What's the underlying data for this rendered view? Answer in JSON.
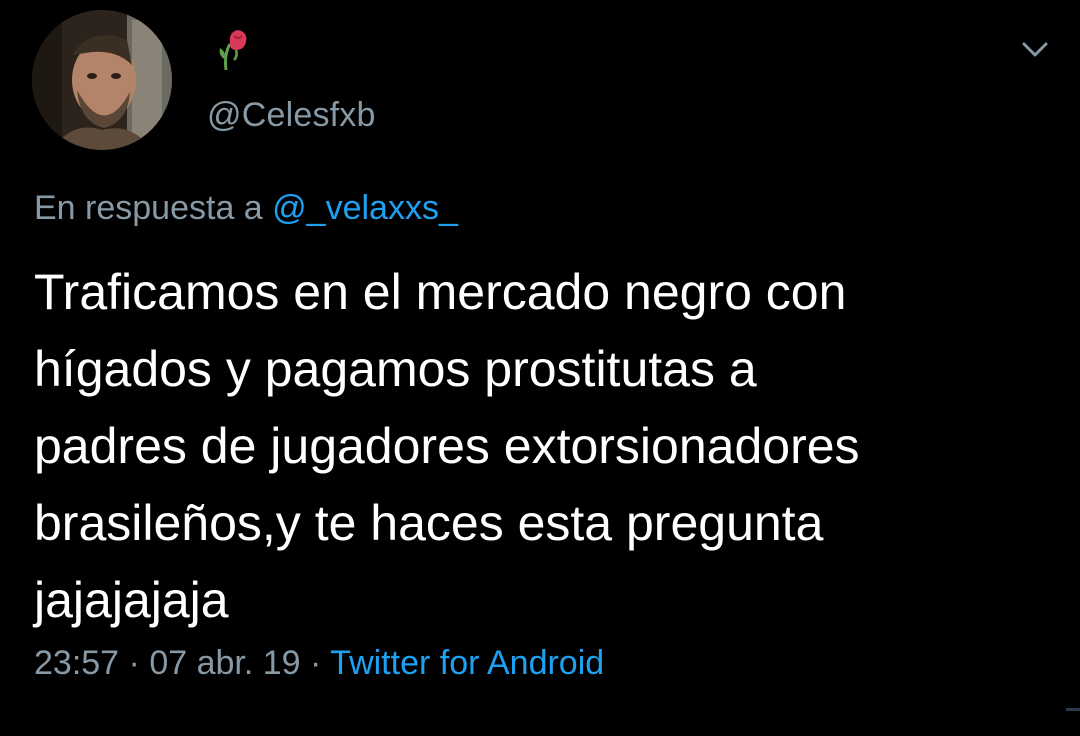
{
  "tweet": {
    "handle": "@Celesfxb",
    "reply_prefix": "En respuesta a ",
    "reply_mention": "@_velaxxs_",
    "text": "Traficamos en el mercado negro con\nhígados y pagamos prostitutas a\npadres de jugadores extorsionadores\nbrasileños,y te haces esta pregunta\njajajajaja",
    "time": "23:57",
    "separator1": " · ",
    "date": "07 abr. 19",
    "separator2": " · ",
    "source": "Twitter for Android"
  },
  "icons": {
    "display_name_emoji": "wilted-rose-icon",
    "menu": "chevron-down-icon"
  },
  "colors": {
    "background": "#000000",
    "text": "#ffffff",
    "muted": "#8899a6",
    "link": "#1da1f2"
  }
}
